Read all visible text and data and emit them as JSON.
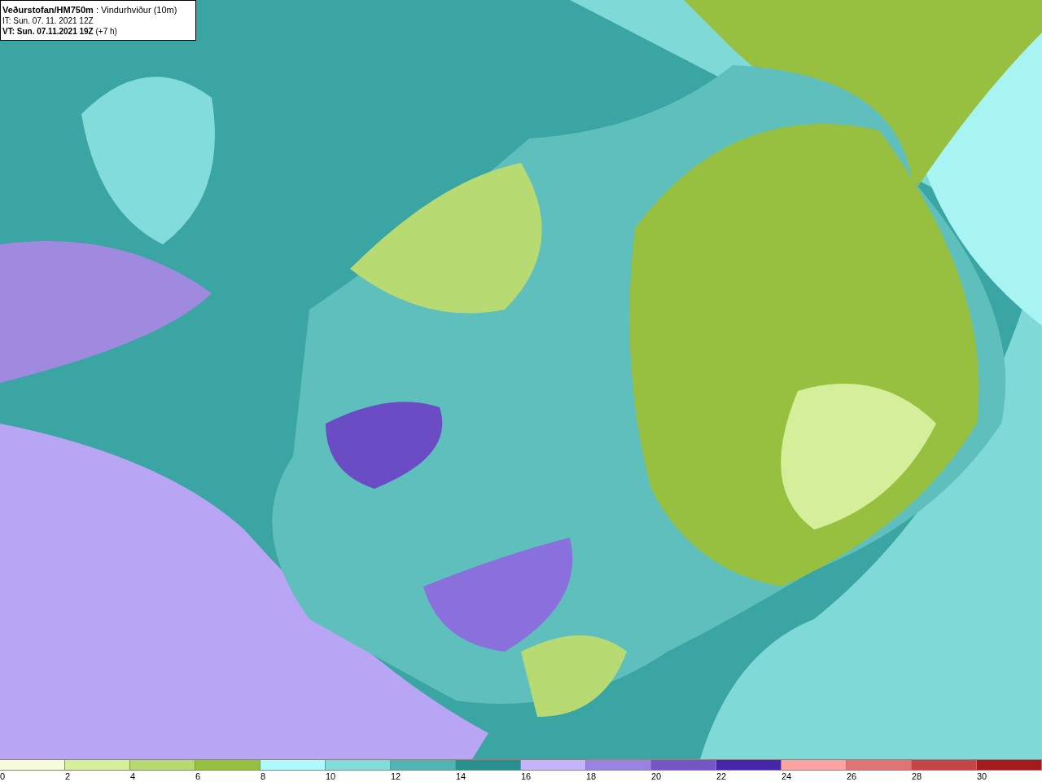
{
  "header": {
    "lines": [
      "**Veðurstofan/HM750m** : Vindurhviður (10m)",
      "IT: Sun. 07. 11. 2021 12Z",
      "**VT: Sun. 07.11.2021 19Z** (+7 h)"
    ]
  },
  "legend": {
    "bins": [
      {
        "color": "#f5fbdc"
      },
      {
        "color": "#d5ee9a"
      },
      {
        "color": "#b8da72"
      },
      {
        "color": "#98c040"
      },
      {
        "color": "#aefafa"
      },
      {
        "color": "#82dcdc"
      },
      {
        "color": "#52b4b4"
      },
      {
        "color": "#2a908e"
      },
      {
        "color": "#c4b4fa"
      },
      {
        "color": "#9a82e0"
      },
      {
        "color": "#7456c6"
      },
      {
        "color": "#4626aa"
      },
      {
        "color": "#fca4a2"
      },
      {
        "color": "#e07474"
      },
      {
        "color": "#c44646"
      },
      {
        "color": "#a41a1a"
      }
    ],
    "labels": [
      "0",
      "2",
      "4",
      "6",
      "8",
      "10",
      "12",
      "14",
      "16",
      "18",
      "20",
      "22",
      "24",
      "26",
      "28",
      "30"
    ]
  }
}
